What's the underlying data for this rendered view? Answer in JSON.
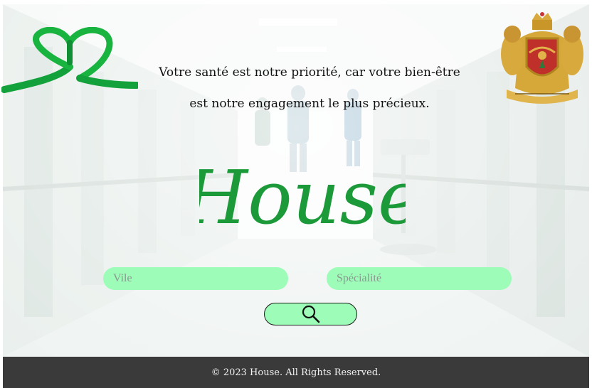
{
  "header": {
    "tagline_line1": "Votre santé est notre priorité, car votre bien-être",
    "tagline_line2": "est notre engagement le plus précieux."
  },
  "brand": {
    "name": "House"
  },
  "search": {
    "city_placeholder": "Vile",
    "specialty_placeholder": "Spécialité",
    "button_icon": "search-icon"
  },
  "footer": {
    "copyright": "© 2023 House. All Rights Reserved."
  },
  "colors": {
    "brand_green": "#1c9a3a",
    "field_green": "#9dfcb8",
    "footer_bg": "#3a3a3a"
  }
}
